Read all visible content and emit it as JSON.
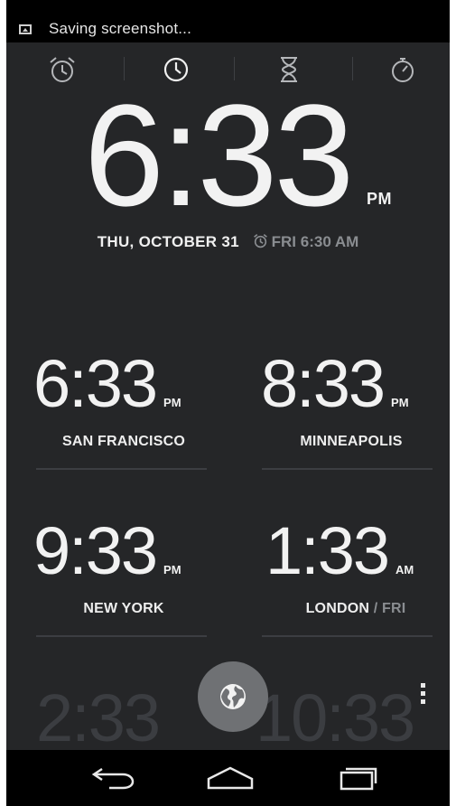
{
  "status_bar": {
    "notification_text": "Saving screenshot..."
  },
  "tabs": [
    {
      "name": "alarm",
      "icon": "alarm-clock-icon"
    },
    {
      "name": "clock",
      "icon": "clock-icon"
    },
    {
      "name": "timer",
      "icon": "hourglass-icon"
    },
    {
      "name": "stopwatch",
      "icon": "stopwatch-icon"
    }
  ],
  "main_clock": {
    "time": "6:33",
    "ampm": "PM",
    "date": "THU, OCTOBER 31",
    "next_alarm": "FRI 6:30 AM"
  },
  "world_clocks": [
    {
      "time": "6:33",
      "ampm": "PM",
      "city": "SAN FRANCISCO",
      "day": ""
    },
    {
      "time": "8:33",
      "ampm": "PM",
      "city": "MINNEAPOLIS",
      "day": ""
    },
    {
      "time": "9:33",
      "ampm": "PM",
      "city": "NEW YORK",
      "day": ""
    },
    {
      "time": "1:33",
      "ampm": "AM",
      "city": "LONDON",
      "day": " / FRI"
    },
    {
      "time": "2:33",
      "ampm": "",
      "city": "",
      "day": ""
    },
    {
      "time": "10:33",
      "ampm": "",
      "city": "",
      "day": ""
    }
  ],
  "fab": {
    "icon": "globe-icon"
  },
  "nav": {
    "back_icon": "back-icon",
    "home_icon": "home-icon",
    "recents_icon": "recents-icon"
  },
  "colors": {
    "background": "#252628",
    "text": "#f2f2f2",
    "muted": "#8a8d91",
    "fab": "#6f7174"
  }
}
